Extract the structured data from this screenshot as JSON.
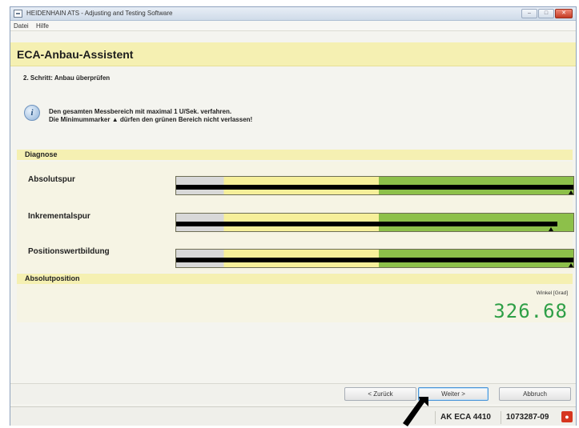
{
  "window": {
    "title": "HEIDENHAIN ATS - Adjusting and Testing Software",
    "controls": [
      "minimize-icon",
      "maximize-icon",
      "close-icon"
    ]
  },
  "menu": {
    "items": [
      "Datei",
      "Hilfe"
    ]
  },
  "wizard": {
    "title": "ECA-Anbau-Assistent",
    "step": "2. Schritt: Anbau überprüfen",
    "info_icon": "info-icon",
    "instructions": [
      "Den gesamten Messbereich mit maximal 1 U/Sek. verfahren.",
      "Die Minimummarker ▲ dürfen den grünen Bereich nicht verlassen!"
    ]
  },
  "diagnose": {
    "header": "Diagnose",
    "zone_colors": {
      "low": "#d8d8d8",
      "mid": "#f6ef9a",
      "ok": "#8dc04a"
    },
    "rows": [
      {
        "label": "Absolutspur",
        "level": 1.0,
        "min_marker": 1.0
      },
      {
        "label": "Inkrementalspur",
        "level": 0.96,
        "min_marker": 0.95
      },
      {
        "label": "Positionswertbildung",
        "level": 1.0,
        "min_marker": 1.0
      }
    ]
  },
  "absolute_position": {
    "header": "Absolutposition",
    "unit_label": "Winkel [Grad]",
    "value": "326.68",
    "value_color": "#2e9f46"
  },
  "buttons": {
    "back": "< Zurück",
    "next": "Weiter >",
    "cancel": "Abbruch"
  },
  "status": {
    "device": "AK ECA 4410",
    "id": "1073287-09",
    "icon": "connection-status-icon"
  }
}
